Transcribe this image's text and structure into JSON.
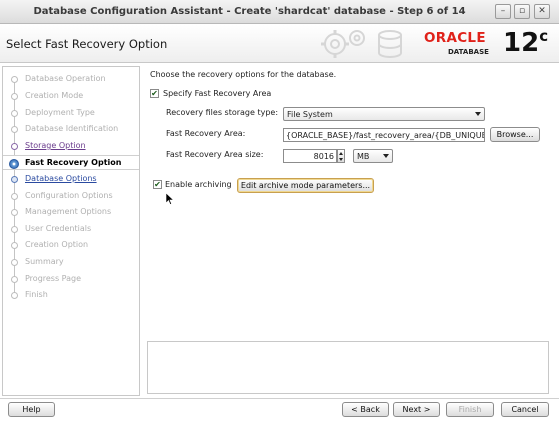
{
  "window": {
    "title": "Database Configuration Assistant - Create 'shardcat' database - Step 6 of 14",
    "controls": {
      "minimize": "–",
      "maximize": "▫",
      "close": "✕"
    }
  },
  "header": {
    "page_title": "Select Fast Recovery Option",
    "brand": "ORACLE",
    "brand_sub": "DATABASE",
    "version": "12",
    "version_suffix": "c"
  },
  "nav": {
    "items": [
      {
        "label": "Database Operation",
        "state": "done"
      },
      {
        "label": "Creation Mode",
        "state": "done"
      },
      {
        "label": "Deployment Type",
        "state": "done"
      },
      {
        "label": "Database Identification",
        "state": "done"
      },
      {
        "label": "Storage Option",
        "state": "link"
      },
      {
        "label": "Fast Recovery Option",
        "state": "current"
      },
      {
        "label": "Database Options",
        "state": "next"
      },
      {
        "label": "Configuration Options",
        "state": "pending"
      },
      {
        "label": "Management Options",
        "state": "pending"
      },
      {
        "label": "User Credentials",
        "state": "pending"
      },
      {
        "label": "Creation Option",
        "state": "pending"
      },
      {
        "label": "Summary",
        "state": "pending"
      },
      {
        "label": "Progress Page",
        "state": "pending"
      },
      {
        "label": "Finish",
        "state": "pending"
      }
    ]
  },
  "main": {
    "intro": "Choose the recovery options for the database.",
    "specify_fra": {
      "label": "Specify Fast Recovery Area",
      "checked": true
    },
    "storage_type": {
      "label": "Recovery files storage type:",
      "value": "File System"
    },
    "fra_location": {
      "label": "Fast Recovery Area:",
      "value": "{ORACLE_BASE}/fast_recovery_area/{DB_UNIQUE_",
      "browse": "Browse..."
    },
    "fra_size": {
      "label": "Fast Recovery Area size:",
      "value": "8016",
      "unit": "MB"
    },
    "archiving": {
      "label": "Enable archiving",
      "checked": true,
      "button": "Edit archive mode parameters..."
    }
  },
  "footer": {
    "help": "Help",
    "back": "< Back",
    "next": "Next >",
    "finish": "Finish",
    "cancel": "Cancel"
  }
}
